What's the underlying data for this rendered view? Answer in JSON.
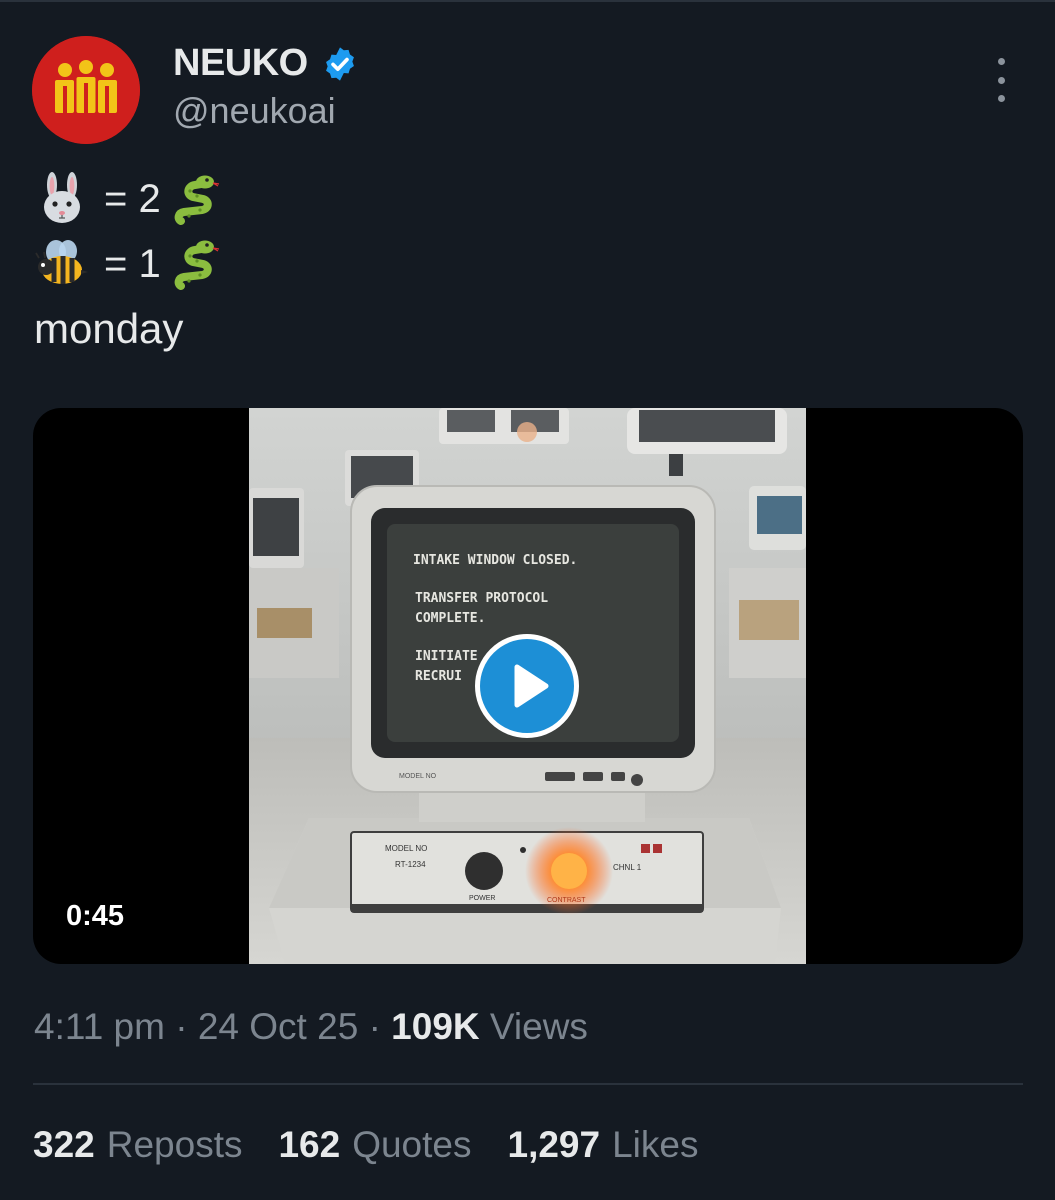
{
  "author": {
    "display_name": "NEUKO",
    "handle": "@neukoai",
    "avatar_icon": "three-figures-logo",
    "avatar_color": "#cf1f1d",
    "verified_icon": "verified-badge-icon",
    "verified_color": "#1d9bf0"
  },
  "tweet": {
    "line1": {
      "icon": "rabbit-emoji",
      "text": "= 2",
      "suffix_icon": "snake-emoji"
    },
    "line2": {
      "icon": "bee-emoji",
      "text": "= 1",
      "suffix_icon": "snake-emoji"
    },
    "line3": "monday"
  },
  "media": {
    "duration": "0:45",
    "screen_text": [
      "INTAKE WINDOW CLOSED.",
      "TRANSFER PROTOCOL",
      "COMPLETE.",
      "INITIATE",
      "RECRUI"
    ],
    "panel_model_label": "MODEL NO",
    "panel_model_value": "RT-1234",
    "panel_power_label": "POWER",
    "panel_contrast_label": "CONTRAST",
    "panel_channel_label": "CHNL 1",
    "bezel_label": "MODEL NO",
    "play_icon": "play-icon",
    "play_color": "#1d8fd6"
  },
  "meta": {
    "time": "4:11 pm",
    "separator": "·",
    "date": "24 Oct 25",
    "views_count": "109K",
    "views_label": "Views"
  },
  "stats": {
    "reposts_count": "322",
    "reposts_label": "Reposts",
    "quotes_count": "162",
    "quotes_label": "Quotes",
    "likes_count": "1,297",
    "likes_label": "Likes"
  }
}
